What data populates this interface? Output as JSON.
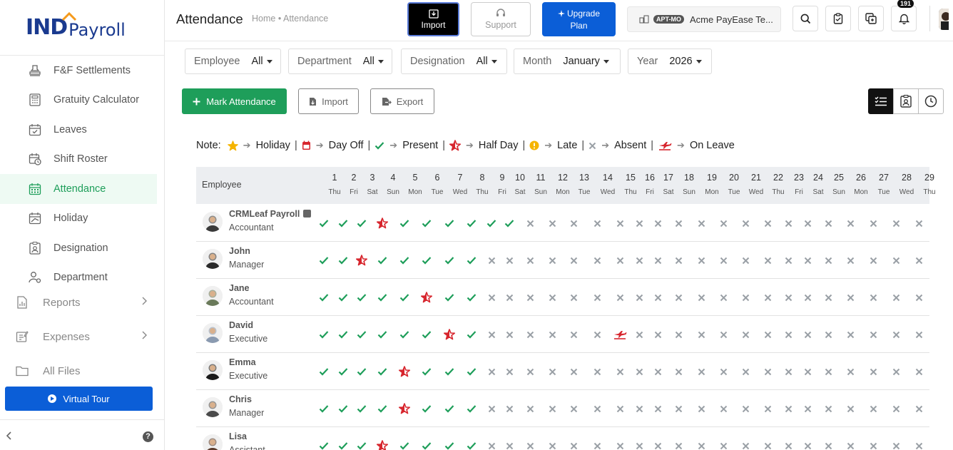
{
  "brand": {
    "ind": "IND",
    "payroll": "Payroll"
  },
  "sidebar": {
    "items": [
      {
        "label": "F&F Settlements",
        "icon": "stamp-icon",
        "active": false
      },
      {
        "label": "Gratuity Calculator",
        "icon": "calculator-icon",
        "active": false
      },
      {
        "label": "Leaves",
        "icon": "calendar-check-icon",
        "active": false
      },
      {
        "label": "Shift Roster",
        "icon": "calendar-clock-icon",
        "active": false
      },
      {
        "label": "Attendance",
        "icon": "calendar-grid-icon",
        "active": true
      },
      {
        "label": "Holiday",
        "icon": "calendar-holiday-icon",
        "active": false
      },
      {
        "label": "Designation",
        "icon": "id-badge-icon",
        "active": false
      },
      {
        "label": "Department",
        "icon": "users-gear-icon",
        "active": false
      }
    ],
    "groups": [
      {
        "label": "Reports",
        "icon": "report-icon",
        "has_children": true
      },
      {
        "label": "Expenses",
        "icon": "expense-icon",
        "has_children": true
      },
      {
        "label": "All Files",
        "icon": "folder-icon",
        "has_children": false
      }
    ],
    "tour_label": "Virtual Tour"
  },
  "header": {
    "title": "Attendance",
    "breadcrumb": "Home • Attendance",
    "import_label": "Import",
    "support_label": "Support",
    "upgrade_line1": "Upgrade",
    "upgrade_line2": "Plan",
    "company_badge": "APT-MO",
    "company_name": "Acme PayEase Te...",
    "notification_count": "191"
  },
  "filters": [
    {
      "label": "Employee",
      "value": "All"
    },
    {
      "label": "Department",
      "value": "All"
    },
    {
      "label": "Designation",
      "value": "All"
    },
    {
      "label": "Month",
      "value": "January"
    },
    {
      "label": "Year",
      "value": "2026"
    }
  ],
  "actions": {
    "mark": "Mark Attendance",
    "import": "Import",
    "export": "Export"
  },
  "legend": {
    "note": "Note:",
    "items": [
      {
        "label": "Holiday",
        "icon": "star-icon"
      },
      {
        "label": "Day Off",
        "icon": "calendar-dayoff-icon"
      },
      {
        "label": "Present",
        "icon": "check-icon"
      },
      {
        "label": "Half Day",
        "icon": "half-day-star-icon"
      },
      {
        "label": "Late",
        "icon": "late-dot-icon"
      },
      {
        "label": "Absent",
        "icon": "cross-icon"
      },
      {
        "label": "On Leave",
        "icon": "plane-icon"
      }
    ]
  },
  "table": {
    "employee_header": "Employee",
    "days": [
      {
        "n": "1",
        "w": "Thu"
      },
      {
        "n": "2",
        "w": "Fri"
      },
      {
        "n": "3",
        "w": "Sat"
      },
      {
        "n": "4",
        "w": "Sun"
      },
      {
        "n": "5",
        "w": "Mon"
      },
      {
        "n": "6",
        "w": "Tue"
      },
      {
        "n": "7",
        "w": "Wed"
      },
      {
        "n": "8",
        "w": "Thu"
      },
      {
        "n": "9",
        "w": "Fri"
      },
      {
        "n": "10",
        "w": "Sat"
      },
      {
        "n": "11",
        "w": "Sun"
      },
      {
        "n": "12",
        "w": "Mon"
      },
      {
        "n": "13",
        "w": "Tue"
      },
      {
        "n": "14",
        "w": "Wed"
      },
      {
        "n": "15",
        "w": "Thu"
      },
      {
        "n": "16",
        "w": "Fri"
      },
      {
        "n": "17",
        "w": "Sat"
      },
      {
        "n": "18",
        "w": "Sun"
      },
      {
        "n": "19",
        "w": "Mon"
      },
      {
        "n": "20",
        "w": "Tue"
      },
      {
        "n": "21",
        "w": "Wed"
      },
      {
        "n": "22",
        "w": "Thu"
      },
      {
        "n": "23",
        "w": "Fri"
      },
      {
        "n": "24",
        "w": "Sat"
      },
      {
        "n": "25",
        "w": "Sun"
      },
      {
        "n": "26",
        "w": "Mon"
      },
      {
        "n": "27",
        "w": "Tue"
      },
      {
        "n": "28",
        "w": "Wed"
      },
      {
        "n": "29",
        "w": "Thu"
      }
    ],
    "rows": [
      {
        "name": "CRMLeaf Payroll",
        "role": "Accountant",
        "badge": true,
        "avatar": "#3a3a3a",
        "status": "PPPHPPPPPPAAAAAAAAAAAAAAAAAAA"
      },
      {
        "name": "John",
        "role": "Manager",
        "badge": false,
        "avatar": "#2a2a2a",
        "status": "PPHPPPPPAAAAAAAAAAAAAAAAAAAAA"
      },
      {
        "name": "Jane",
        "role": "Accountant",
        "badge": false,
        "avatar": "#6a7a5a",
        "status": "PPPPPHPPAAAAAAAAAAAAAAAAAAAAA"
      },
      {
        "name": "David",
        "role": "Executive",
        "badge": false,
        "avatar": "#8a9ab0",
        "status": "PPPPPPHPAAAAAALAAAAAAAAAAAAAA"
      },
      {
        "name": "Emma",
        "role": "Executive",
        "badge": false,
        "avatar": "#1a1a1a",
        "status": "PPPPHPPPAAAAAAAAAAAAAAAAAAAAA"
      },
      {
        "name": "Chris",
        "role": "Manager",
        "badge": false,
        "avatar": "#4a4a4a",
        "status": "PPPPHPPPAAAAAAAAAAAAAAAAAAAAA"
      },
      {
        "name": "Lisa",
        "role": "Assistant",
        "badge": false,
        "avatar": "#5a3a2a",
        "status": "PPPHPPPPAAAAAAAAAAAAAAAAAAAAA"
      }
    ]
  },
  "colors": {
    "present": "#1e9e5a",
    "absent": "#9aa0a6",
    "half_day": "#d7262e",
    "holiday": "#f5b400",
    "accent": "#0b5ed7"
  }
}
